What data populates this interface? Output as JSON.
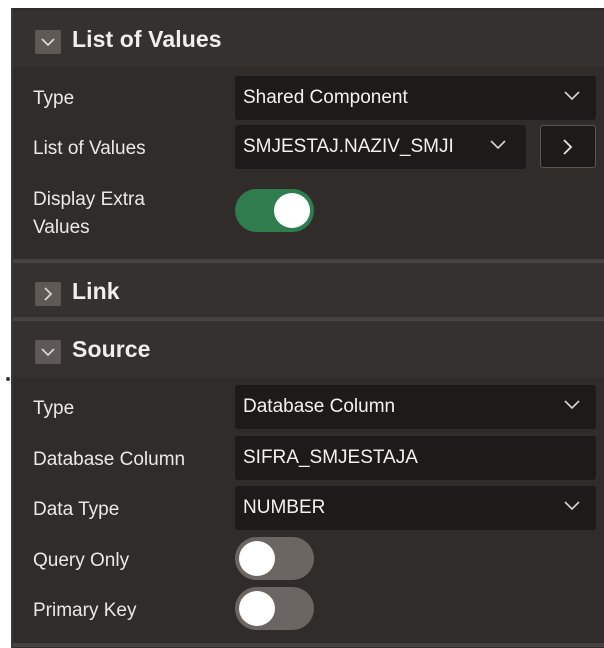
{
  "colors": {
    "panel_bg": "#2f2c2a",
    "header_bg": "#35312e",
    "field_bg": "#1d1b1a",
    "switch_on": "#2f7d4f",
    "switch_off": "#6b6661",
    "text": "#ece9e5"
  },
  "lov_section": {
    "title": "List of Values",
    "expanded": true,
    "toggle_icon": "chevron-down-icon",
    "type_label": "Type",
    "type_value": "Shared Component",
    "lov_label": "List of Values",
    "lov_value": "SMJESTAJ.NAZIV_SMJI",
    "display_extra_label_line1": "Display Extra",
    "display_extra_label_line2": "Values",
    "display_extra_on": true
  },
  "link_section": {
    "title": "Link",
    "expanded": false,
    "toggle_icon": "chevron-right-icon"
  },
  "source_section": {
    "title": "Source",
    "expanded": true,
    "toggle_icon": "chevron-down-icon",
    "type_label": "Type",
    "type_value": "Database Column",
    "db_column_label": "Database Column",
    "db_column_value": "SIFRA_SMJESTAJA",
    "data_type_label": "Data Type",
    "data_type_value": "NUMBER",
    "query_only_label": "Query Only",
    "query_only_on": false,
    "primary_key_label": "Primary Key",
    "primary_key_on": false
  }
}
